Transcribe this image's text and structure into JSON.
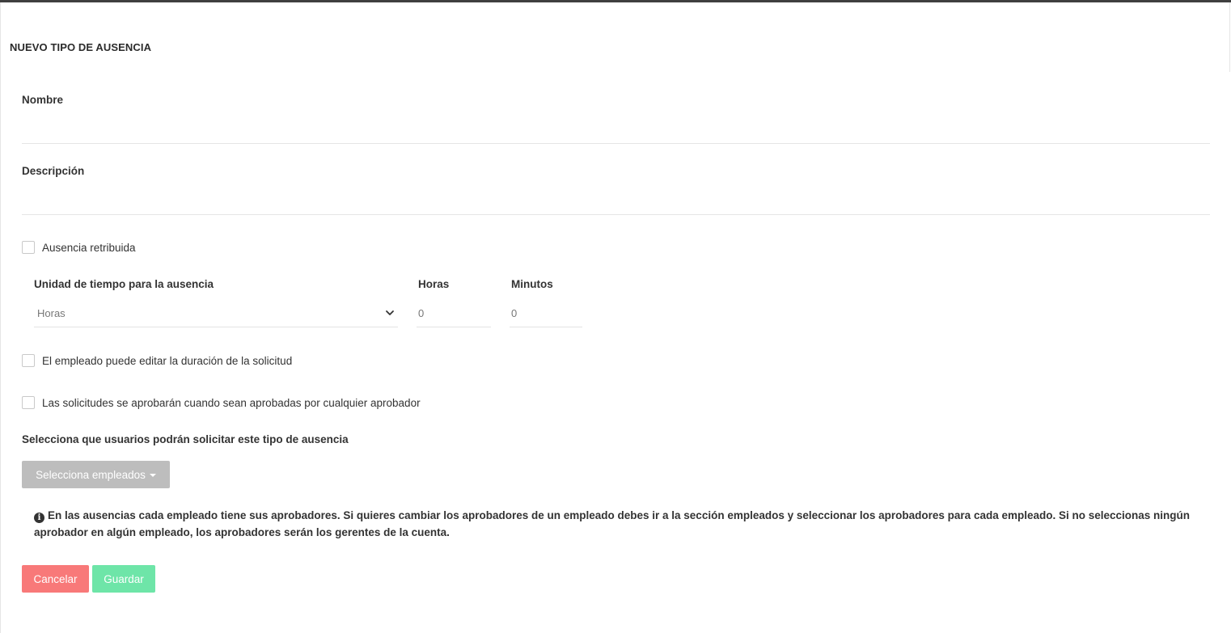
{
  "page": {
    "title": "NUEVO TIPO DE AUSENCIA"
  },
  "form": {
    "nombre": {
      "label": "Nombre",
      "value": ""
    },
    "descripcion": {
      "label": "Descripción",
      "value": ""
    },
    "retribuida": {
      "label": "Ausencia retribuida",
      "checked": false
    },
    "unidad": {
      "label": "Unidad de tiempo para la ausencia",
      "selected": "Horas"
    },
    "horas": {
      "label": "Horas",
      "value": "0"
    },
    "minutos": {
      "label": "Minutos",
      "value": "0"
    },
    "editar_duracion": {
      "label": "El empleado puede editar la duración de la solicitud",
      "checked": false
    },
    "cualquier_aprobador": {
      "label": "Las solicitudes se aprobarán cuando sean aprobadas por cualquier aprobador",
      "checked": false
    },
    "usuarios": {
      "label": "Selecciona que usuarios podrán solicitar este tipo de ausencia",
      "button_label": "Selecciona empleados"
    },
    "info": {
      "icon": "info-circle-icon",
      "text": "En las ausencias cada empleado tiene sus aprobadores. Si quieres cambiar los aprobadores de un empleado debes ir a la sección empleados y seleccionar los aprobadores para cada empleado. Si no seleccionas ningún aprobador en algún empleado, los aprobadores serán los gerentes de la cuenta."
    }
  },
  "actions": {
    "cancel_label": "Cancelar",
    "save_label": "Guardar"
  },
  "colors": {
    "cancel": "#f87979",
    "save": "#6ee5a8",
    "employees_button": "#bdbdbd"
  }
}
